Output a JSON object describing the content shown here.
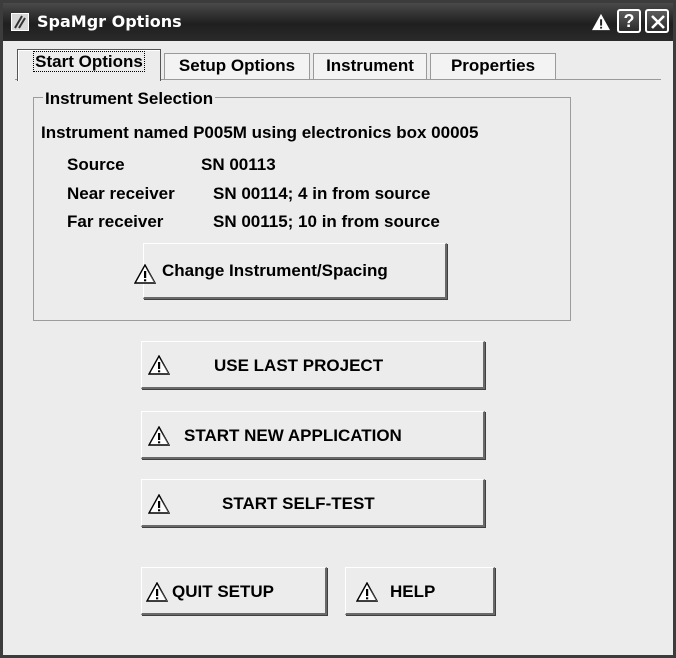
{
  "window": {
    "title": "SpaMgr Options",
    "help_label": "?"
  },
  "tabs": [
    {
      "label": "Start Options",
      "active": true
    },
    {
      "label": "Setup Options",
      "active": false
    },
    {
      "label": "Instrument",
      "active": false
    },
    {
      "label": "Properties",
      "active": false
    }
  ],
  "instrument_selection": {
    "legend": "Instrument Selection",
    "summary": "Instrument named P005M using electronics box 00005",
    "rows": [
      {
        "label": "Source",
        "value": "SN 00113"
      },
      {
        "label": "Near receiver",
        "value": "SN 00114; 4 in from source"
      },
      {
        "label": "Far receiver",
        "value": "SN 00115; 10 in from source"
      }
    ],
    "change_button": "Change Instrument/Spacing"
  },
  "actions": {
    "use_last_project": "USE LAST PROJECT",
    "start_new_application": "START NEW APPLICATION",
    "start_self_test": "START SELF-TEST",
    "quit_setup": "QUIT SETUP",
    "help": "HELP"
  },
  "icons": {
    "warning": "warning-triangle-icon",
    "close": "close-x-icon",
    "app": "app-logo-icon"
  }
}
